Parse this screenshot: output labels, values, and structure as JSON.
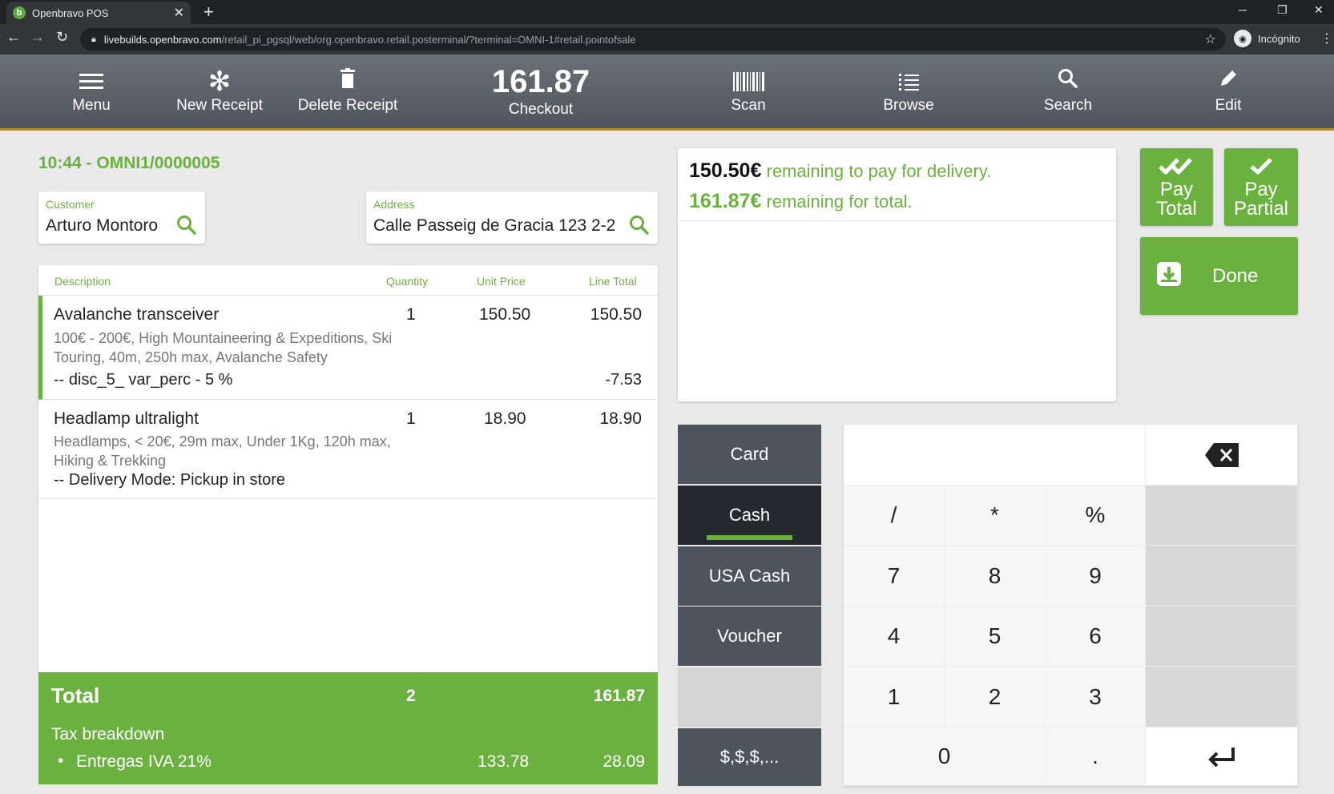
{
  "browser": {
    "tab_title": "Openbravo POS",
    "favicon": "b",
    "tab_close": "✕",
    "new_tab": "+",
    "url_host": "livebuilds.openbravo.com",
    "url_path": "/retail_pi_pgsql/web/org.openbravo.retail.posterminal/?terminal=OMNI-1#retail.pointofsale",
    "profile_label": "Incógnito",
    "minimize": "─",
    "restore": "❐",
    "close": "✕"
  },
  "toolbar": {
    "menu_label": "Menu",
    "new_receipt_label": "New Receipt",
    "delete_receipt_label": "Delete Receipt",
    "checkout_amount": "161.87",
    "checkout_label": "Checkout",
    "scan_label": "Scan",
    "browse_label": "Browse",
    "search_label": "Search",
    "edit_label": "Edit"
  },
  "receipt": {
    "id_line": "10:44 - OMNI1/0000005",
    "customer_label": "Customer",
    "customer_value": "Arturo Montoro",
    "address_label": "Address",
    "address_value": "Calle Passeig de Gracia 123 2-2"
  },
  "lines": {
    "headers": {
      "description": "Description",
      "quantity": "Quantity",
      "unit_price": "Unit Price",
      "line_total": "Line Total"
    },
    "items": [
      {
        "name": "Avalanche transceiver",
        "qty": "1",
        "unit_price": "150.50",
        "total": "150.50",
        "attr1": "100€ - 200€, High Mountaineering & Expeditions, Ski",
        "attr2": "Touring, 40m, 250h max, Avalanche Safety",
        "discount_label": "-- disc_5_ var_perc - 5 %",
        "discount_amount": "-7.53"
      },
      {
        "name": "Headlamp ultralight",
        "qty": "1",
        "unit_price": "18.90",
        "total": "18.90",
        "attr1": "Headlamps, < 20€, 29m max, Under 1Kg, 120h max,",
        "attr2": "Hiking & Trekking",
        "delivery_label": "-- Delivery Mode: Pickup in store"
      }
    ]
  },
  "totals": {
    "label": "Total",
    "qty": "2",
    "amount": "161.87",
    "tax_title": "Tax breakdown",
    "tax_name": "Entregas IVA 21%",
    "tax_base": "133.78",
    "tax_amount": "28.09"
  },
  "payment": {
    "delivery_amount": "150.50€",
    "delivery_text": " remaining to pay for delivery.",
    "total_amount": "161.87€",
    "total_text": " remaining for total.",
    "pay_total_l1": "Pay",
    "pay_total_l2": "Total",
    "pay_partial_l1": "Pay",
    "pay_partial_l2": "Partial",
    "done_label": "Done",
    "methods": [
      "Card",
      "Cash",
      "USA Cash",
      "Voucher",
      "",
      "$,$,$,..."
    ],
    "selected_method": "Cash"
  },
  "keypad": {
    "display": "",
    "keys": [
      "/",
      "*",
      "%",
      "7",
      "8",
      "9",
      "4",
      "5",
      "6",
      "1",
      "2",
      "3",
      "0",
      "."
    ],
    "backspace": "⌫",
    "enter": "↵"
  },
  "colors": {
    "accent": "#6bb13f",
    "toolbar": "#5b6168",
    "method_bg": "#4e545b",
    "method_active": "#26292d"
  }
}
